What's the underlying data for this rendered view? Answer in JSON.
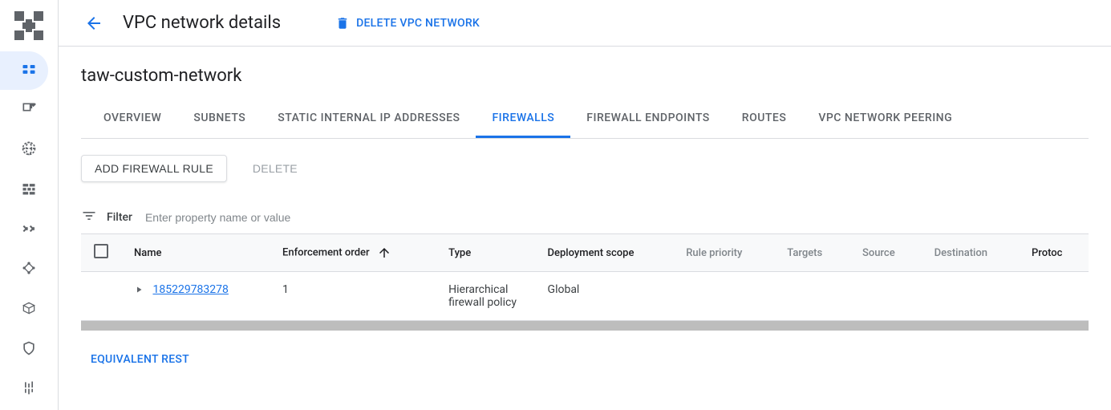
{
  "header": {
    "page_title": "VPC network details",
    "delete_label": "DELETE VPC NETWORK"
  },
  "network_name": "taw-custom-network",
  "tabs": [
    {
      "label": "OVERVIEW"
    },
    {
      "label": "SUBNETS"
    },
    {
      "label": "STATIC INTERNAL IP ADDRESSES"
    },
    {
      "label": "FIREWALLS",
      "active": true
    },
    {
      "label": "FIREWALL ENDPOINTS"
    },
    {
      "label": "ROUTES"
    },
    {
      "label": "VPC NETWORK PEERING"
    }
  ],
  "actions": {
    "add_firewall_rule": "ADD FIREWALL RULE",
    "delete": "DELETE"
  },
  "filter": {
    "label": "Filter",
    "placeholder": "Enter property name or value"
  },
  "table": {
    "columns": {
      "name": "Name",
      "enforcement_order": "Enforcement order",
      "type": "Type",
      "deployment_scope": "Deployment scope",
      "rule_priority": "Rule priority",
      "targets": "Targets",
      "source": "Source",
      "destination": "Destination",
      "protocols": "Protoc"
    },
    "rows": [
      {
        "name": "185229783278",
        "enforcement_order": "1",
        "type": "Hierarchical firewall policy",
        "deployment_scope": "Global",
        "rule_priority": "",
        "targets": "",
        "source": "",
        "destination": "",
        "protocols": ""
      }
    ]
  },
  "equivalent_rest": "EQUIVALENT REST"
}
